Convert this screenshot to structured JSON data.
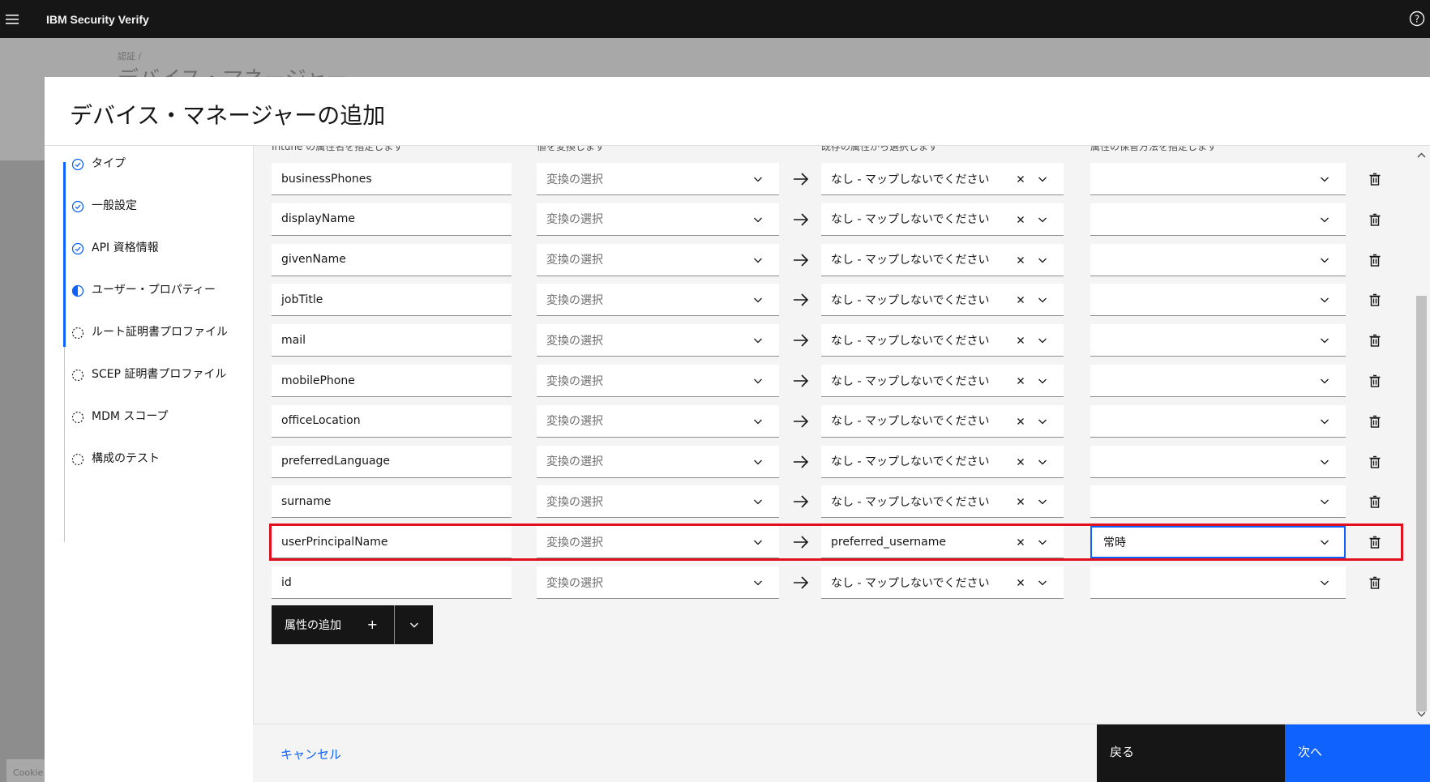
{
  "app": {
    "title": "IBM Security Verify"
  },
  "background": {
    "breadcrumb": "認証 /",
    "title": "デバイス・マネージャー",
    "cookie_label": "Cookie"
  },
  "modal": {
    "title": "デバイス・マネージャーの追加"
  },
  "steps": [
    {
      "label": "タイプ",
      "state": "complete"
    },
    {
      "label": "一般設定",
      "state": "complete"
    },
    {
      "label": "API 資格情報",
      "state": "complete"
    },
    {
      "label": "ユーザー・プロパティー",
      "state": "current"
    },
    {
      "label": "ルート証明書プロファイル",
      "state": "incomplete"
    },
    {
      "label": "SCEP 証明書プロファイル",
      "state": "incomplete"
    },
    {
      "label": "MDM スコープ",
      "state": "incomplete"
    },
    {
      "label": "構成のテスト",
      "state": "incomplete"
    }
  ],
  "column_hints": {
    "name": "Intune の属性名を指定します",
    "transform": "値を変換します",
    "source": "既存の属性から選択します",
    "store": "属性の保管方法を指定します"
  },
  "rows": [
    {
      "name": "businessPhones",
      "transform": "変換の選択",
      "source": "なし - マップしないでください",
      "store": ""
    },
    {
      "name": "displayName",
      "transform": "変換の選択",
      "source": "なし - マップしないでください",
      "store": ""
    },
    {
      "name": "givenName",
      "transform": "変換の選択",
      "source": "なし - マップしないでください",
      "store": ""
    },
    {
      "name": "jobTitle",
      "transform": "変換の選択",
      "source": "なし - マップしないでください",
      "store": ""
    },
    {
      "name": "mail",
      "transform": "変換の選択",
      "source": "なし - マップしないでください",
      "store": ""
    },
    {
      "name": "mobilePhone",
      "transform": "変換の選択",
      "source": "なし - マップしないでください",
      "store": ""
    },
    {
      "name": "officeLocation",
      "transform": "変換の選択",
      "source": "なし - マップしないでください",
      "store": ""
    },
    {
      "name": "preferredLanguage",
      "transform": "変換の選択",
      "source": "なし - マップしないでください",
      "store": ""
    },
    {
      "name": "surname",
      "transform": "変換の選択",
      "source": "なし - マップしないでください",
      "store": ""
    },
    {
      "name": "userPrincipalName",
      "transform": "変換の選択",
      "source": "preferred_username",
      "store": "常時",
      "highlighted": true
    },
    {
      "name": "id",
      "transform": "変換の選択",
      "source": "なし - マップしないでください",
      "store": ""
    }
  ],
  "add_attribute": {
    "label": "属性の追加",
    "plus": "+"
  },
  "footer": {
    "cancel": "キャンセル",
    "back": "戻る",
    "next": "次へ"
  },
  "colors": {
    "primary": "#0f62fe",
    "dark": "#161616",
    "highlight": "#e0101e",
    "field_bg": "#ffffff",
    "content_bg": "#f4f4f4"
  }
}
